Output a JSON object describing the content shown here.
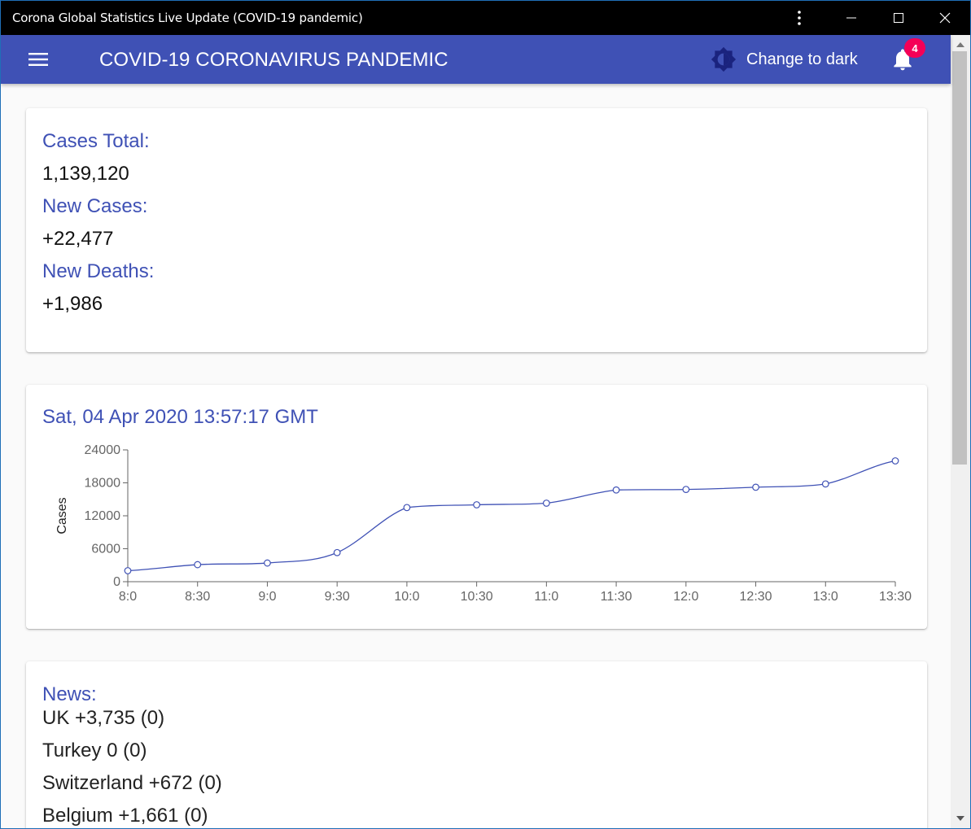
{
  "window": {
    "title": "Corona Global Statistics Live Update (COVID-19 pandemic)"
  },
  "appbar": {
    "title": "COVID-19 CORONAVIRUS PANDEMIC",
    "theme_toggle_label": "Change to dark",
    "notification_count": "4",
    "color": "#3f51b5"
  },
  "summary": {
    "cases_total_label": "Cases Total:",
    "cases_total_value": "1,139,120",
    "new_cases_label": "New Cases:",
    "new_cases_value": "+22,477",
    "new_deaths_label": "New Deaths:",
    "new_deaths_value": "+1,986"
  },
  "chart_card": {
    "timestamp": "Sat, 04 Apr 2020 13:57:17 GMT"
  },
  "chart_data": {
    "type": "line",
    "title": "",
    "xlabel": "",
    "ylabel": "Cases",
    "x": [
      "8:0",
      "8:30",
      "9:0",
      "9:30",
      "10:0",
      "10:30",
      "11:0",
      "11:30",
      "12:0",
      "12:30",
      "13:0",
      "13:30"
    ],
    "y_ticks": [
      "0",
      "6000",
      "12000",
      "18000",
      "24000"
    ],
    "ylim": [
      0,
      24000
    ],
    "grid": false,
    "series": [
      {
        "color": "#3f51b5",
        "values": [
          2000,
          3100,
          3400,
          5300,
          13500,
          14000,
          14300,
          16700,
          16800,
          17200,
          17800,
          22000
        ]
      }
    ]
  },
  "news": {
    "label": "News:",
    "items": [
      "UK +3,735 (0)",
      "Turkey 0 (0)",
      "Switzerland +672 (0)",
      "Belgium +1,661 (0)"
    ]
  }
}
